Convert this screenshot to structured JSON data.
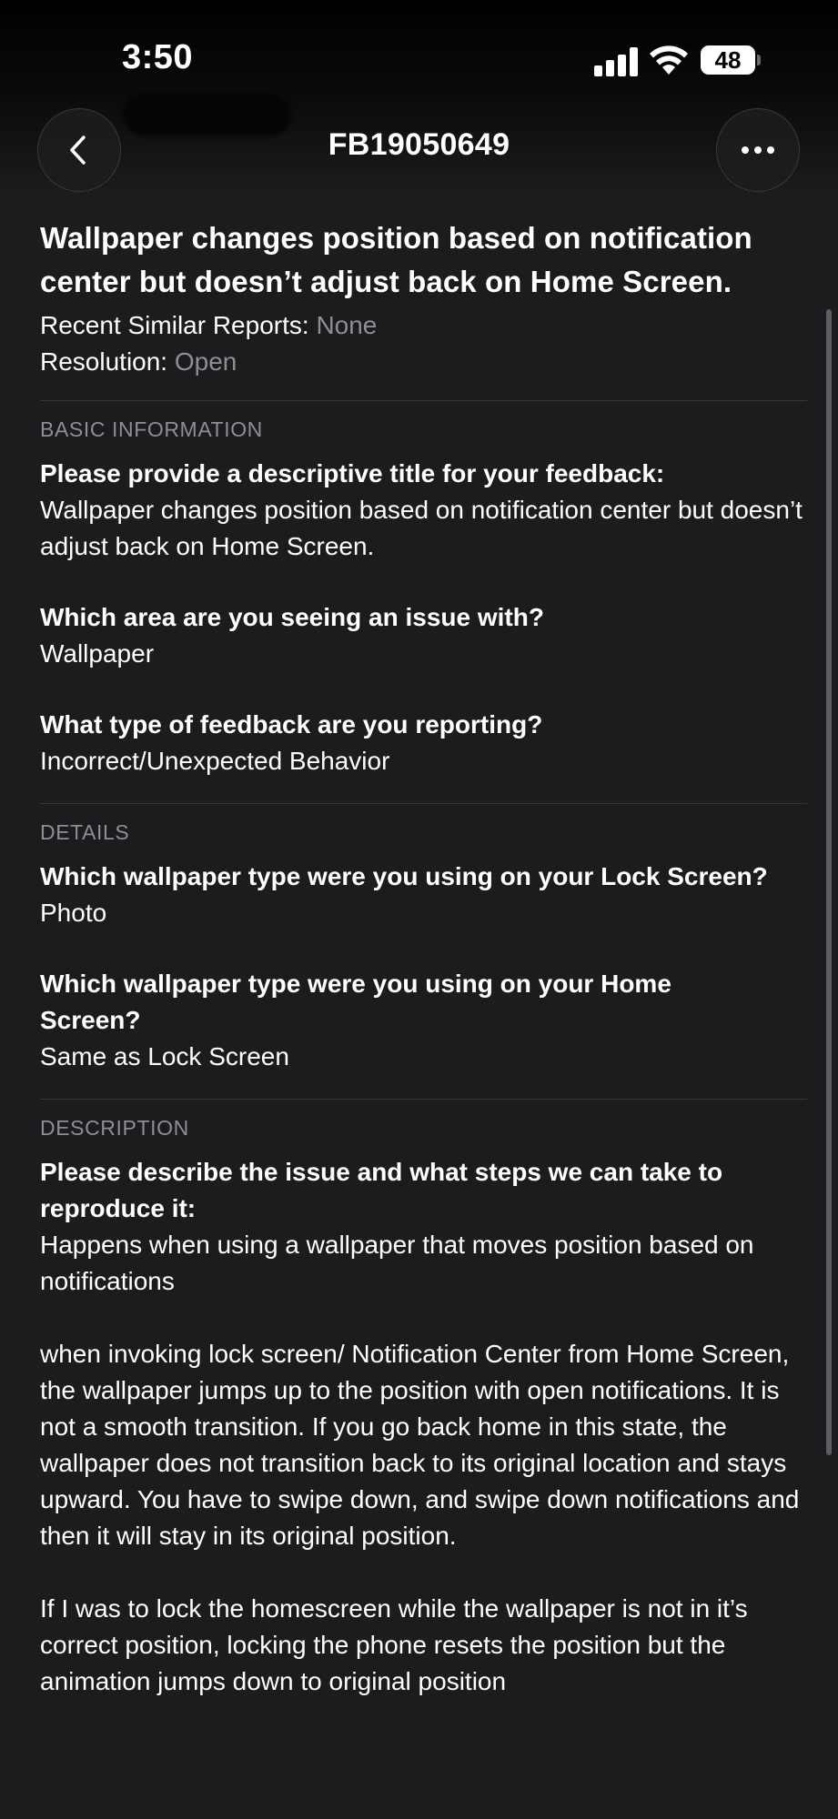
{
  "status_bar": {
    "time": "3:50",
    "battery": "48",
    "icons": [
      "signal-icon",
      "wifi-icon",
      "battery-icon"
    ]
  },
  "nav": {
    "title": "FB19050649",
    "back_icon": "chevron-left-icon",
    "more_icon": "ellipsis-icon"
  },
  "report": {
    "title": "Wallpaper changes position based on notification center but doesn’t adjust back on Home Screen.",
    "similar_label": "Recent Similar Reports: ",
    "similar_value": "None",
    "resolution_label": "Resolution: ",
    "resolution_value": "Open"
  },
  "sections": {
    "basic": {
      "header": "BASIC INFORMATION",
      "q1": "Please provide a descriptive title for your feedback:",
      "a1": "Wallpaper changes position based on notification center but doesn’t adjust back on Home Screen.",
      "q2": "Which area are you seeing an issue with?",
      "a2": "Wallpaper",
      "q3": "What type of feedback are you reporting?",
      "a3": "Incorrect/Unexpected Behavior"
    },
    "details": {
      "header": "DETAILS",
      "q1": "Which wallpaper type were you using on your Lock Screen?",
      "a1": "Photo",
      "q2": "Which wallpaper type were you using on your Home Screen?",
      "a2": "Same as Lock Screen"
    },
    "description": {
      "header": "DESCRIPTION",
      "q1": "Please describe the issue and what steps we can take to reproduce it:",
      "p1": "Happens when using a wallpaper that moves position based on notifications",
      "p2": "when invoking lock screen/ Notification Center from Home Screen, the wallpaper jumps up to the position with open notifications. It is not a smooth transition. If you go back home in this state, the wallpaper does not transition back to its original location and stays upward. You have to swipe down, and swipe down notifications and then it will stay in its original position.",
      "p3": "If I was to lock the homescreen while the wallpaper is not in it’s correct position, locking the phone resets the position but the animation jumps down to original position"
    }
  },
  "colors": {
    "background": "#1c1c1e",
    "secondary_text": "#8e8e93",
    "divider": "#38383a"
  }
}
